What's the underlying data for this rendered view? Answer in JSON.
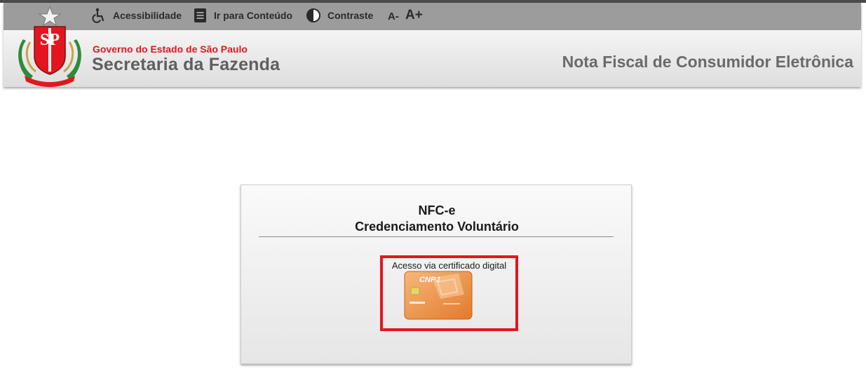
{
  "accessibility_bar": {
    "accessibility_label": "Acessibilidade",
    "skip_to_content_label": "Ir para Conteúdo",
    "contrast_label": "Contraste",
    "font_decrease_label": "A-",
    "font_increase_label": "A+"
  },
  "branding": {
    "logo_letters": "SP",
    "government": "Governo do Estado de São Paulo",
    "secretariat": "Secretaria da Fazenda",
    "system_title": "Nota Fiscal de Consumidor Eletrônica"
  },
  "panel": {
    "title_line1": "NFC-e",
    "title_line2": "Credenciamento Voluntário",
    "certificate_access_label": "Acesso via certificado digital",
    "card_text": "CNPJ"
  },
  "colors": {
    "brand_red": "#e0161e",
    "highlight_border": "#e3161f",
    "accessibility_bar_bg": "#9c9c9c"
  },
  "icons": [
    "wheelchair-icon",
    "document-icon",
    "contrast-icon",
    "certificate-card-icon",
    "sp-coat-of-arms-logo"
  ]
}
